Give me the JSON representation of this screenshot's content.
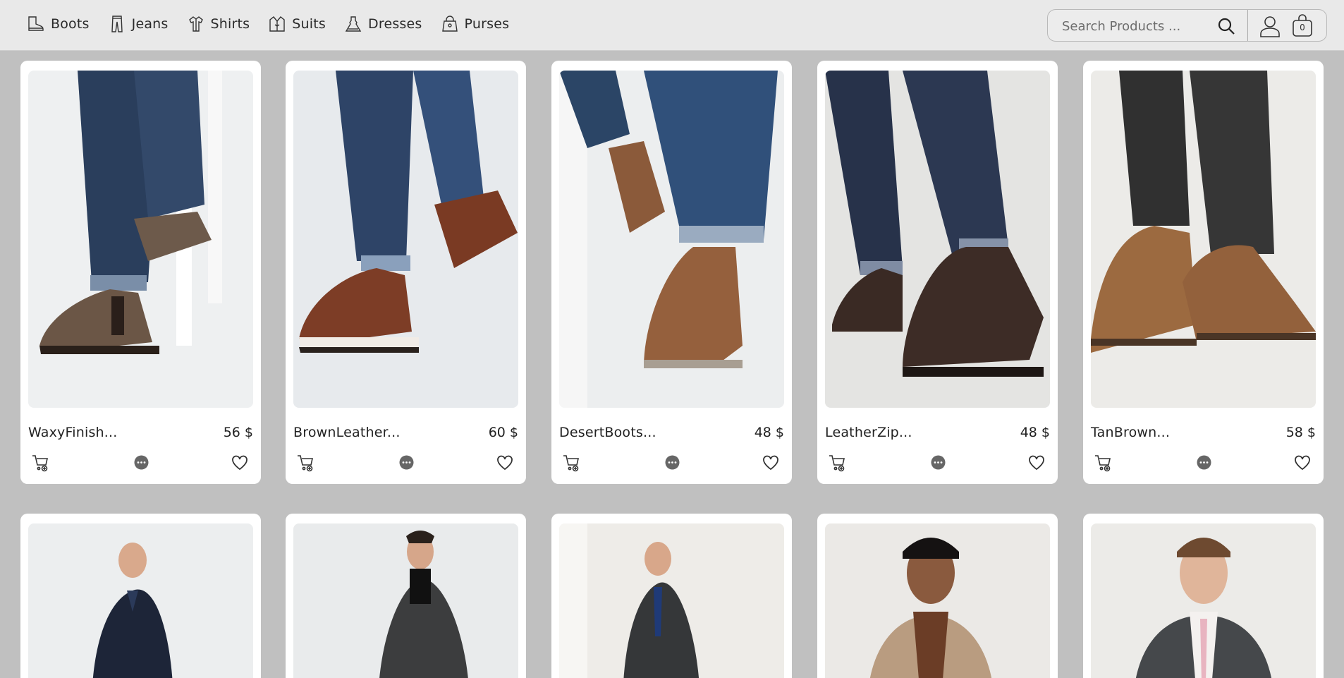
{
  "nav": {
    "items": [
      {
        "label": "Boots",
        "icon": "boot-icon"
      },
      {
        "label": "Jeans",
        "icon": "jeans-icon"
      },
      {
        "label": "Shirts",
        "icon": "shirt-icon"
      },
      {
        "label": "Suits",
        "icon": "suit-icon"
      },
      {
        "label": "Dresses",
        "icon": "dress-icon"
      },
      {
        "label": "Purses",
        "icon": "purse-icon"
      }
    ]
  },
  "search": {
    "placeholder": "Search Products ...",
    "value": ""
  },
  "cart": {
    "count": "0"
  },
  "products": [
    {
      "name": "WaxyFinish...",
      "price": "56 $"
    },
    {
      "name": "BrownLeather...",
      "price": "60 $"
    },
    {
      "name": "DesertBoots...",
      "price": "48 $"
    },
    {
      "name": "LeatherZip...",
      "price": "48 $"
    },
    {
      "name": "TanBrown...",
      "price": "58 $"
    }
  ],
  "colors": {
    "header_bg": "#e9e9e9",
    "page_bg": "#c0c0c0",
    "card_bg": "#ffffff",
    "text": "#222222"
  }
}
